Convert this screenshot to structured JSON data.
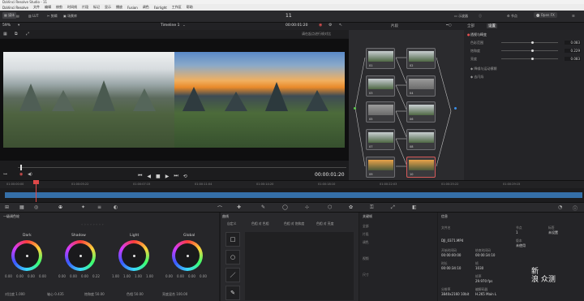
{
  "window": {
    "title": "DaVinci Resolve Studio - 11",
    "menu": [
      "DaVinci Resolve",
      "文件",
      "编辑",
      "修剪",
      "时间线",
      "片段",
      "标记",
      "显示",
      "播放",
      "Fusion",
      "调色",
      "Fairlight",
      "工作区",
      "帮助"
    ]
  },
  "toolbar": {
    "buttons": [
      "媒体",
      "LUT",
      "剪辑",
      "场景库"
    ],
    "project_title": "11",
    "right_buttons": [
      "示波器",
      "信息",
      "节点",
      "Open FX"
    ]
  },
  "viewer": {
    "zoom": "59%",
    "clip_name": "Timeline 1",
    "timecode_top": "00:00:01:20",
    "tool_label": "请在起点进行帧对比",
    "timecode_main": "00:00:01:20"
  },
  "nodes": {
    "header_label": "片段",
    "items": [
      "01",
      "02",
      "03",
      "04",
      "05",
      "06",
      "07",
      "08",
      "09",
      "10"
    ]
  },
  "right_panel": {
    "tabs": [
      "全部",
      "设置"
    ],
    "section": "透视与畸变",
    "rows": [
      {
        "label": "色彩范围",
        "value": "0.083",
        "level": 0.55
      },
      {
        "label": "饱和度",
        "value": "0.229",
        "level": 0.55
      },
      {
        "label": "亮度",
        "value": "0.083",
        "level": 0.55
      }
    ],
    "subsections": [
      "◆ 降噪与运动模糊",
      "◆ 去闪烁"
    ]
  },
  "timeline": {
    "ticks": [
      "01:00:00:00",
      "01:00:05:22",
      "01:00:07:15",
      "01:00:11:04",
      "01:00:14:20",
      "01:00:18:10",
      "01:00:22:03",
      "01:00:25:22",
      "01:00:29:15"
    ]
  },
  "wheels": {
    "header": "一级调色轮",
    "items": [
      {
        "name": "Dark",
        "values": [
          "0.00",
          "0.00",
          "0.00",
          "0.00"
        ]
      },
      {
        "name": "Shadow",
        "values": [
          "0.00",
          "0.00",
          "0.00",
          "0.22"
        ]
      },
      {
        "name": "Light",
        "values": [
          "1.00",
          "1.00",
          "1.00",
          "1.00"
        ]
      },
      {
        "name": "Global",
        "values": [
          "0.00",
          "0.00",
          "0.00",
          "0.00"
        ]
      }
    ],
    "footer": [
      "对比度 1.000",
      "轴心 0.435",
      "饱和度 50.00",
      "色相 50.00",
      "亮度混合 100.00"
    ]
  },
  "curves": {
    "header": "曲线",
    "tabs": [
      "自定义",
      "色相 对 色相",
      "色相 对 饱和度",
      "色相 对 亮度"
    ],
    "tools": [
      "□",
      "○",
      "／",
      "✎"
    ]
  },
  "keyframes": {
    "header": "关键帧",
    "rows": [
      "全部",
      "片段",
      "调色",
      "视频",
      "尺寸"
    ]
  },
  "info": {
    "header": "信息",
    "clip": "DJI_0371.MP4",
    "fields": [
      {
        "k": "文件名",
        "v": "DJI_0371.MP4"
      },
      {
        "k": "开始时间码",
        "v": "00:00:00:00"
      },
      {
        "k": "结束时间码",
        "v": "00:00:34:10"
      },
      {
        "k": "时长",
        "v": "00:00:34:10"
      },
      {
        "k": "帧",
        "v": "1030"
      },
      {
        "k": "帧率",
        "v": "29.970 fps"
      },
      {
        "k": "分辨率",
        "v": "3840x2160 10bit"
      },
      {
        "k": "编解码器",
        "v": "H.265 Main L"
      }
    ],
    "right_fields": [
      {
        "k": "节点",
        "v": "1"
      },
      {
        "k": "标签",
        "v": "未设置"
      },
      {
        "k": "版本",
        "v": "未使用"
      }
    ]
  },
  "watermark": {
    "line1": "新",
    "line2": "浪",
    "line3": "众测"
  }
}
